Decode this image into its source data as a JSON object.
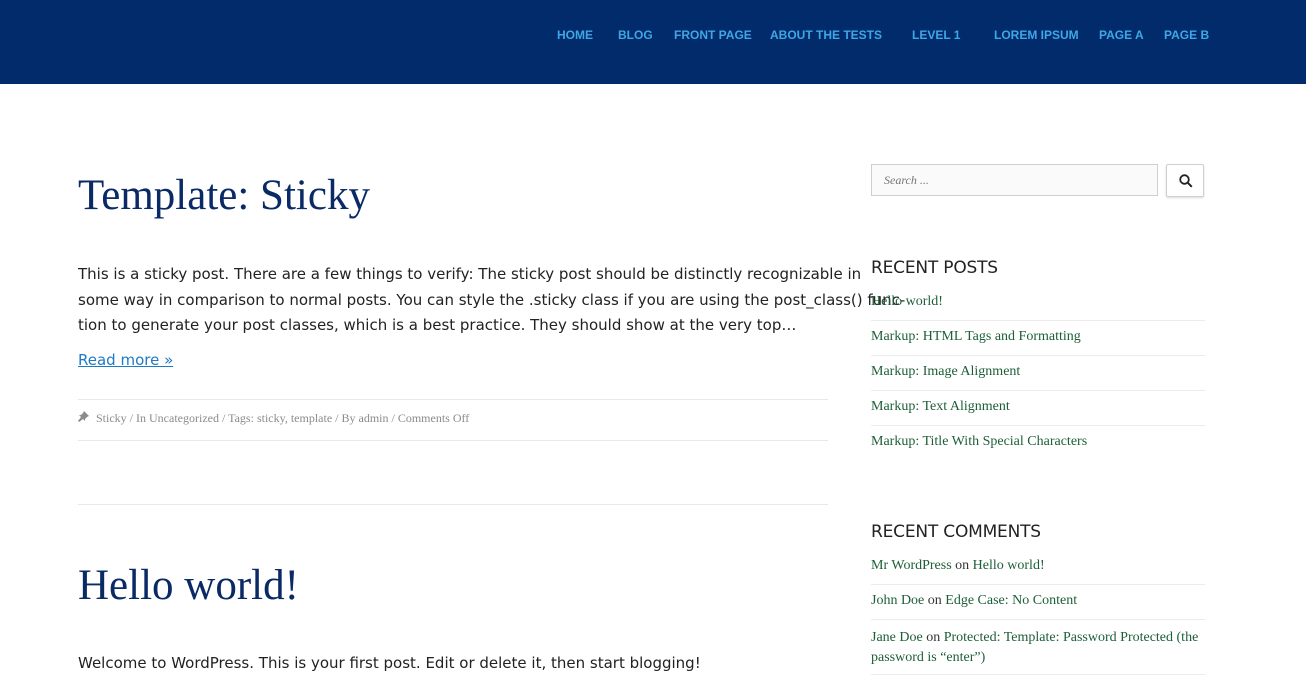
{
  "nav": {
    "items": [
      {
        "label": "HOME"
      },
      {
        "label": "BLOG"
      },
      {
        "label": "FRONT PAGE"
      },
      {
        "label": "ABOUT THE TESTS"
      },
      {
        "label": "LEVEL 1"
      },
      {
        "label": "LOREM IPSUM"
      },
      {
        "label": "PAGE A"
      },
      {
        "label": "PAGE B"
      }
    ]
  },
  "posts": [
    {
      "title": "Template: Sticky",
      "excerpt_lines": [
        "This is a sticky post. There are a few things to verify: The sticky post should be distinctly recognizable in",
        "some way in comparison to normal posts. You can style the .sticky class if you are using the post_class() func-",
        "tion to generate your post classes, which is a best practice. They should show at the very top…"
      ],
      "read_more": "Read more »",
      "meta": {
        "sticky": "Sticky",
        "sep1": " / In ",
        "category": "Uncategorized",
        "sep2": " / Tags: ",
        "tag1": "sticky",
        "comma": ", ",
        "tag2": "template",
        "sep3": " / By ",
        "author": "admin",
        "sep4": " / ",
        "comments": "Comments Off"
      }
    },
    {
      "title": "Hello world!",
      "excerpt": "Welcome to WordPress. This is your first post. Edit or delete it, then start blogging!"
    }
  ],
  "sidebar": {
    "search": {
      "placeholder": "Search ..."
    },
    "recent_posts": {
      "title": "RECENT POSTS",
      "items": [
        "Hello world!",
        "Markup: HTML Tags and Formatting",
        "Markup: Image Alignment",
        "Markup: Text Alignment",
        "Markup: Title With Special Characters"
      ]
    },
    "recent_comments": {
      "title": "RECENT COMMENTS",
      "items": [
        {
          "author": "Mr WordPress",
          "on": " on ",
          "post": "Hello world!"
        },
        {
          "author": "John Doe",
          "on": " on ",
          "post": "Edge Case: No Content"
        },
        {
          "author": "Jane Doe",
          "on": " on ",
          "post": "Protected: Template: Password Protected (the",
          "post_line2": "password is “enter”)"
        }
      ]
    }
  },
  "colors": {
    "header_bg": "#022b6b",
    "nav_link": "#3ea7e6",
    "title": "#0a2a66",
    "link_blue": "#1e7ac5",
    "sidebar_link": "#1c5e37"
  },
  "icons": {
    "search": "search-icon",
    "pin": "pin-icon"
  }
}
